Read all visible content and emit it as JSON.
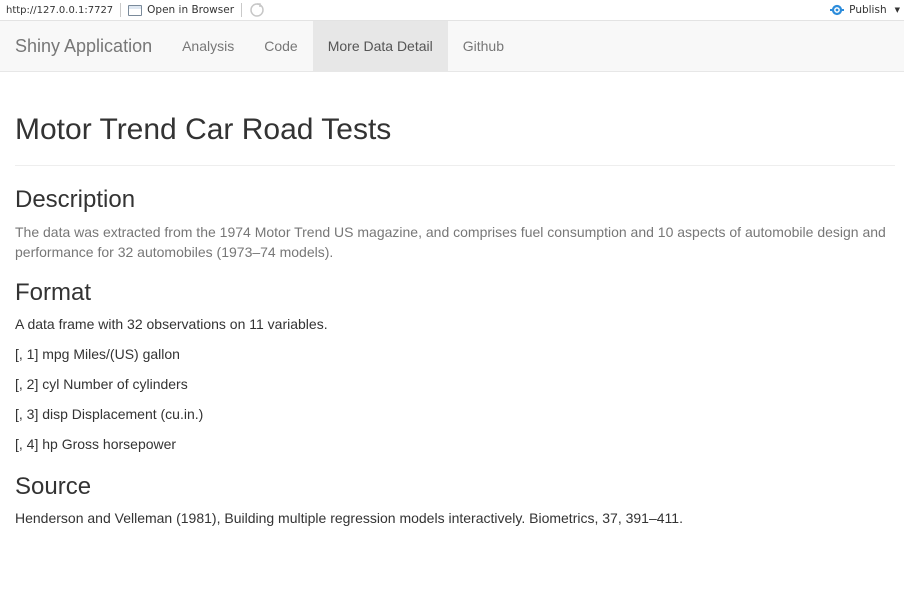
{
  "viewer": {
    "url": "http://127.0.0.1:7727",
    "open_in_browser_label": "Open in Browser",
    "publish_label": "Publish"
  },
  "navbar": {
    "brand": "Shiny Application",
    "tabs": [
      {
        "label": "Analysis",
        "active": false
      },
      {
        "label": "Code",
        "active": false
      },
      {
        "label": "More Data Detail",
        "active": true
      },
      {
        "label": "Github",
        "active": false
      }
    ]
  },
  "page": {
    "title": "Motor Trend Car Road Tests",
    "description_heading": "Description",
    "description_text": "The data was extracted from the 1974 Motor Trend US magazine, and comprises fuel consumption and 10 aspects of automobile design and performance for 32 automobiles (1973–74 models).",
    "format_heading": "Format",
    "format_intro": "A data frame with 32 observations on 11 variables.",
    "variables": [
      "[, 1] mpg Miles/(US) gallon",
      "[, 2] cyl Number of cylinders",
      "[, 3] disp Displacement (cu.in.)",
      "[, 4] hp Gross horsepower"
    ],
    "source_heading": "Source",
    "source_text": "Henderson and Velleman (1981), Building multiple regression models interactively. Biometrics, 37, 391–411."
  },
  "colors": {
    "navbar_bg": "#f8f8f8",
    "nav_active_bg": "#e7e7e7",
    "nav_text": "#777777",
    "muted_text": "#777777",
    "body_text": "#333333",
    "publish_icon": "#2c8cdb"
  }
}
